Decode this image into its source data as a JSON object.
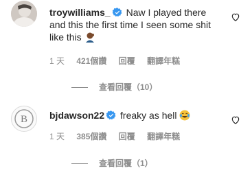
{
  "comments": [
    {
      "username": "troywilliams_",
      "text": "Naw I played there and this the first time I seen some shit like this",
      "emoji": "man-facepalming-emoji",
      "time": "1 天",
      "likes": "421個讚",
      "reply_label": "回覆",
      "translate_label": "翻譯年糕",
      "view_replies": "查看回覆（10）"
    },
    {
      "username": "bjdawson22",
      "text": "freaky as hell",
      "emoji": "face-with-tears-of-joy-emoji",
      "time": "1 天",
      "likes": "385個讚",
      "reply_label": "回覆",
      "translate_label": "翻譯年糕",
      "view_replies": "查看回覆（1）"
    }
  ],
  "colors": {
    "verified": "#3897f0",
    "meta": "#8e8e8e",
    "text": "#262626"
  }
}
